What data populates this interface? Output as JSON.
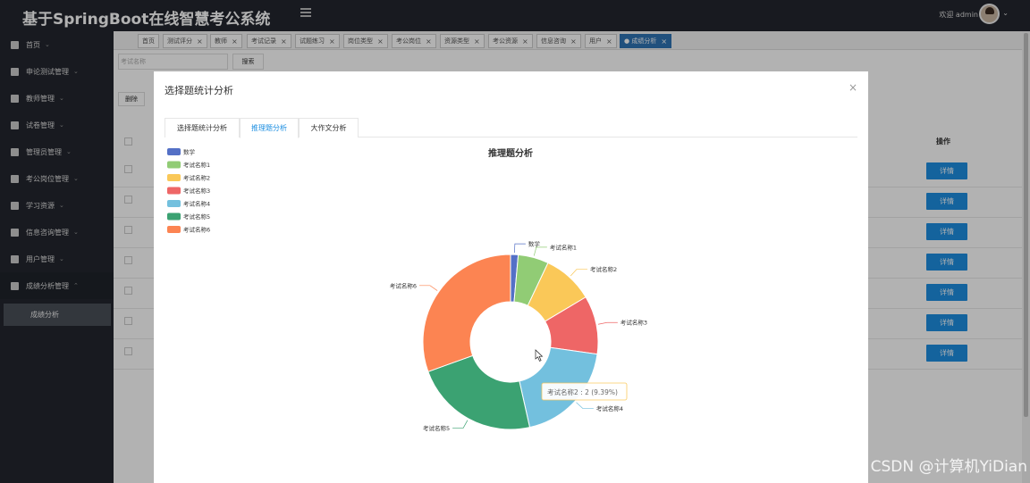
{
  "app": {
    "title": "基于SpringBoot在线智慧考公系统",
    "welcome": "欢迎 admin"
  },
  "sidebar": {
    "items": [
      {
        "label": "首页"
      },
      {
        "label": "申论测试管理"
      },
      {
        "label": "教师管理"
      },
      {
        "label": "试卷管理"
      },
      {
        "label": "管理员管理"
      },
      {
        "label": "考公岗位管理"
      },
      {
        "label": "学习资源"
      },
      {
        "label": "信息咨询管理"
      },
      {
        "label": "用户管理"
      },
      {
        "label": "成绩分析管理"
      }
    ],
    "sub_item": "成绩分析"
  },
  "tabs": [
    {
      "label": "首页",
      "closable": false
    },
    {
      "label": "测试评分",
      "closable": true
    },
    {
      "label": "教师",
      "closable": true
    },
    {
      "label": "考试记录",
      "closable": true
    },
    {
      "label": "试题练习",
      "closable": true
    },
    {
      "label": "岗位类型",
      "closable": true
    },
    {
      "label": "考公岗位",
      "closable": true
    },
    {
      "label": "资源类型",
      "closable": true
    },
    {
      "label": "考公资源",
      "closable": true
    },
    {
      "label": "信息咨询",
      "closable": true
    },
    {
      "label": "用户",
      "closable": true
    },
    {
      "label": "● 成绩分析",
      "closable": true
    }
  ],
  "filter": {
    "placeholder": "考试名称",
    "search_label": "搜索",
    "delete_label": "删除"
  },
  "table": {
    "op_header": "操作",
    "detail_label": "详情",
    "row_count": 7
  },
  "modal": {
    "title": "选择题统计分析",
    "close": "×",
    "tabs": [
      "选择题统计分析",
      "推理题分析",
      "大作文分析"
    ],
    "active_tab": 1
  },
  "tooltip": "考试名称2 : 2 (9.39%)",
  "chart_data": {
    "type": "pie",
    "title": "推理题分析",
    "donut": true,
    "categories": [
      "数学",
      "考试名称1",
      "考试名称2",
      "考试名称3",
      "考试名称4",
      "考试名称5",
      "考试名称6"
    ],
    "values": [
      0.3,
      1.2,
      2,
      2.3,
      4.1,
      4.9,
      6.5
    ],
    "colors": [
      "#5470c6",
      "#91cc75",
      "#fac858",
      "#ee6666",
      "#73c0de",
      "#3ba272",
      "#fc8452"
    ],
    "legend_position": "top-left"
  },
  "watermark": "CSDN @计算机YiDian"
}
